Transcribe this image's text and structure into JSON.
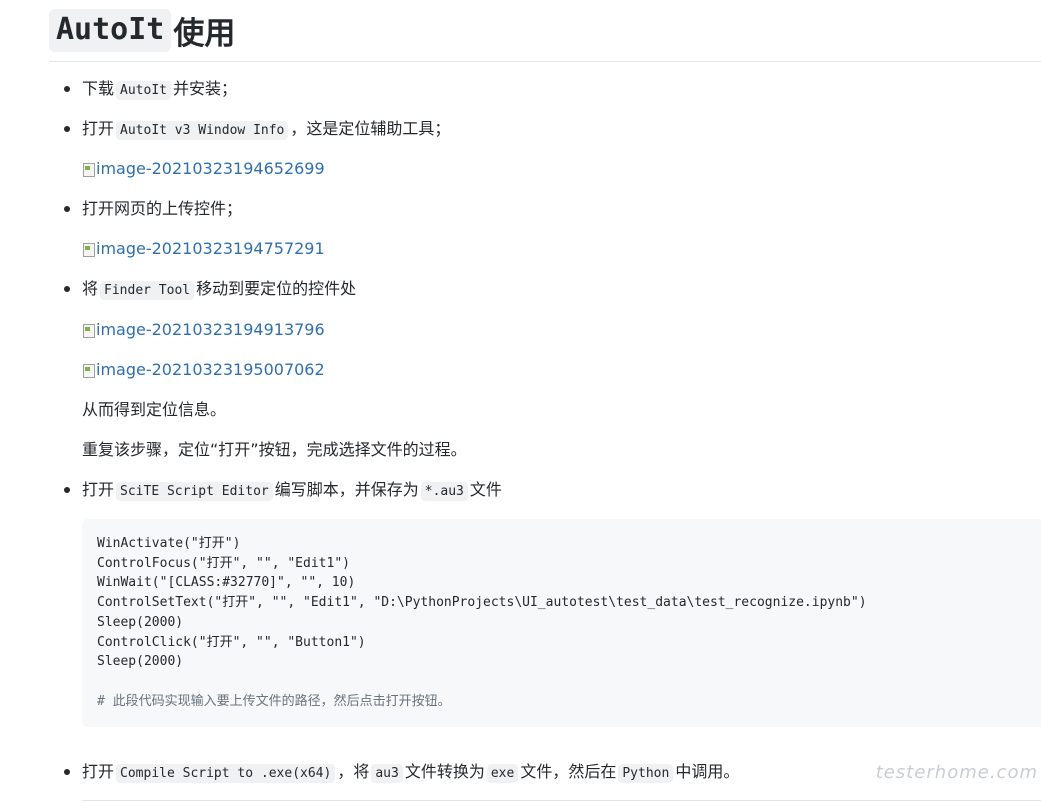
{
  "header": {
    "title_code": "AutoIt",
    "title_rest": "使用"
  },
  "steps": [
    {
      "pre": "下载",
      "code": "AutoIt",
      "post": "并安装；"
    },
    {
      "pre": "打开",
      "code": "AutoIt v3 Window Info",
      "post": "，这是定位辅助工具；"
    },
    {
      "text": "打开网页的上传控件；"
    },
    {
      "pre": "将",
      "code": "Finder Tool",
      "post": "移动到要定位的控件处"
    },
    {
      "pre": "打开",
      "code": "SciTE Script Editor",
      "mid": "编写脚本，并保存为",
      "code2": "*.au3",
      "post": "文件"
    },
    {
      "pre": "打开",
      "code": "Compile Script to .exe(x64)",
      "mid": "，将",
      "code2": "au3",
      "mid2": "文件转换为",
      "code3": "exe",
      "mid3": "文件，然后在",
      "code4": "Python",
      "post": "中调用。"
    }
  ],
  "images": [
    "image-20210323194652699",
    "image-20210323194757291",
    "image-20210323194913796",
    "image-20210323195007062"
  ],
  "paragraphs": [
    "从而得到定位信息。",
    "重复该步骤，定位“打开”按钮，完成选择文件的过程。"
  ],
  "code_lines": [
    "WinActivate(\"打开\")",
    "ControlFocus(\"打开\", \"\", \"Edit1\")",
    "WinWait(\"[CLASS:#32770]\", \"\", 10)",
    "ControlSetText(\"打开\", \"\", \"Edit1\", \"D:\\PythonProjects\\UI_autotest\\test_data\\test_recognize.ipynb\")",
    "Sleep(2000)",
    "ControlClick(\"打开\", \"\", \"Button1\")",
    "Sleep(2000)",
    "",
    "# 此段代码实现输入要上传文件的路径，然后点击打开按钮。"
  ],
  "watermark": "testerhome.com",
  "colors": {
    "link": "#2f6fb0",
    "code_bg": "#eff1f3",
    "block_bg": "#f6f8fa",
    "text": "#24292e"
  }
}
